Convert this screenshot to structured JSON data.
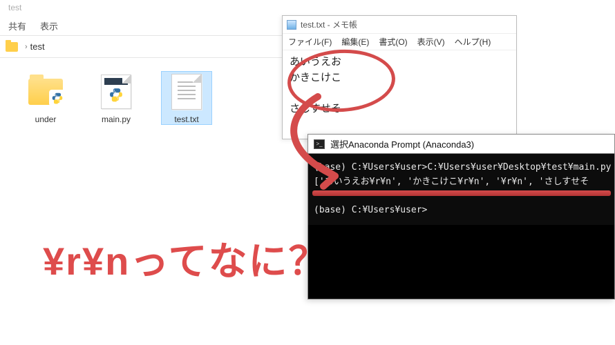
{
  "explorer": {
    "window_title": "test",
    "menu": {
      "share": "共有",
      "view": "表示"
    },
    "path_folder_name": "test",
    "items": [
      {
        "label": "under",
        "type": "folder-python"
      },
      {
        "label": "main.py",
        "type": "python-file"
      },
      {
        "label": "test.txt",
        "type": "text-file",
        "selected": true
      }
    ]
  },
  "notepad": {
    "title": "test.txt - メモ帳",
    "menu": {
      "file": "ファイル(F)",
      "edit": "編集(E)",
      "format": "書式(O)",
      "view": "表示(V)",
      "help": "ヘルプ(H)"
    },
    "content_lines": [
      "あいうえお",
      "かきこけこ",
      "",
      "さしすせそ"
    ]
  },
  "console": {
    "title": "選択Anaconda Prompt (Anaconda3)",
    "lines": [
      "(base) C:¥Users¥user>C:¥Users¥user¥Desktop¥test¥main.py",
      "['あいうえお¥r¥n', 'かきこけこ¥r¥n', '¥r¥n', 'さしすせそ",
      "",
      "(base) C:¥Users¥user>"
    ]
  },
  "annotation": {
    "question_text": "¥r¥nってなに？"
  }
}
